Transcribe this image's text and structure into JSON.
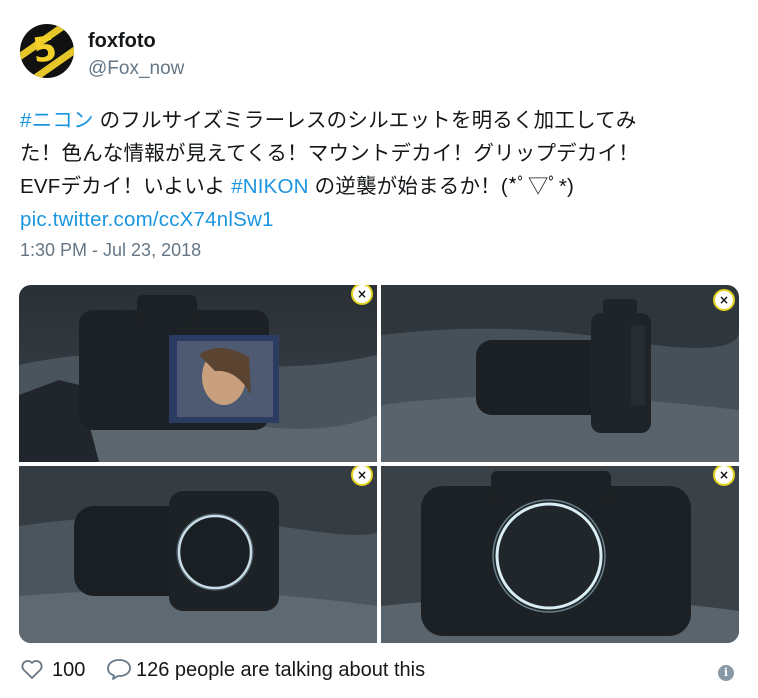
{
  "author": {
    "display_name": "foxfoto",
    "handle": "@Fox_now",
    "avatar_text": "5"
  },
  "tweet": {
    "line1": {
      "hashtag": "#ニコン",
      "text": " のフルサイズミラーレスのシルエットを明るく加工してみ"
    },
    "line2": "た！色んな情報が見えてくる！マウントデカイ！グリップデカイ！",
    "line3": {
      "before": "EVFデカイ！いよいよ ",
      "hashtag": "#NIKON",
      "after": " の逆襲が始まるか！(*ﾟ▽ﾟ*)"
    },
    "link": "pic.twitter.com/ccX74nlSw1"
  },
  "timestamp": "1:30 PM - Jul 23, 2018",
  "media": {
    "close_glyph": "×",
    "tiles": [
      {
        "desc_icon": "camera-rear-screen"
      },
      {
        "desc_icon": "camera-lens-side"
      },
      {
        "desc_icon": "camera-mount-ring"
      },
      {
        "desc_icon": "camera-mount-closeup"
      }
    ]
  },
  "footer": {
    "likes": "100",
    "talking": "126 people are talking about this",
    "info_glyph": "i"
  },
  "colors": {
    "link_blue": "#1b95e0",
    "secondary_gray": "#657786",
    "close_ring": "#e3d21e"
  }
}
